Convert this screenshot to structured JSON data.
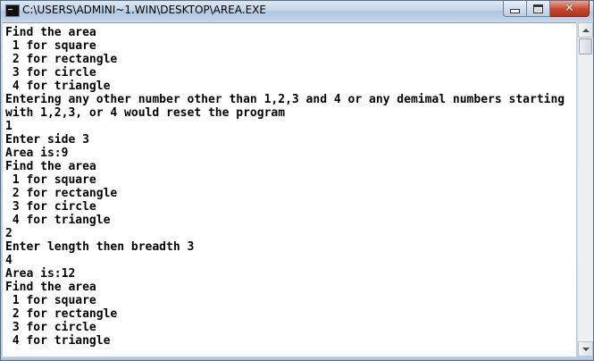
{
  "window": {
    "title": "C:\\USERS\\ADMINI~1.WIN\\DESKTOP\\AREA.EXE",
    "close_symbol": "✕"
  },
  "console": {
    "lines": [
      "Find the area",
      " 1 for square",
      " 2 for rectangle",
      " 3 for circle",
      " 4 for triangle",
      "Entering any other number other than 1,2,3 and 4 or any demimal numbers starting",
      "with 1,2,3, or 4 would reset the program",
      "1",
      "Enter side 3",
      "Area is:9",
      "Find the area",
      " 1 for square",
      " 2 for rectangle",
      " 3 for circle",
      " 4 for triangle",
      "2",
      "Enter length then breadth 3",
      "4",
      "Area is:12",
      "Find the area",
      " 1 for square",
      " 2 for rectangle",
      " 3 for circle",
      " 4 for triangle"
    ]
  },
  "icons": {
    "app": "console-icon",
    "minimize": "minimize-icon",
    "maximize": "maximize-icon",
    "close": "close-icon",
    "scroll_up": "chevron-up-icon",
    "scroll_down": "chevron-down-icon"
  },
  "colors": {
    "console_background": "#ffffff",
    "console_text": "#000000",
    "close_button": "#c9462b"
  }
}
